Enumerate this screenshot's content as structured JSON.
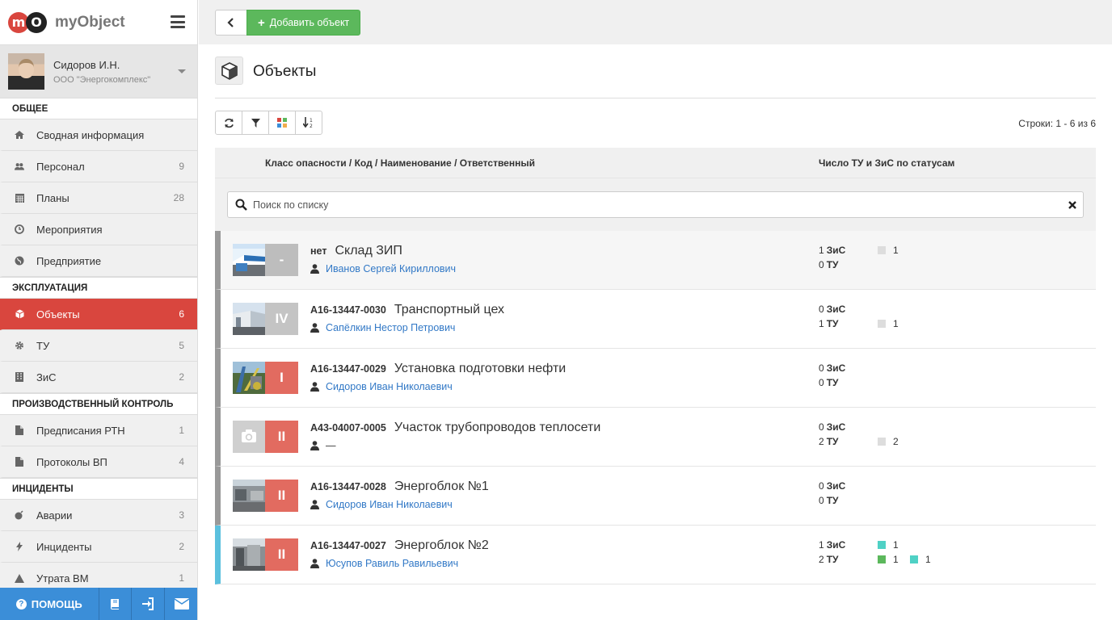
{
  "brand": {
    "logo_letter_1": "m",
    "logo_letter_2": "O",
    "name": "myObject"
  },
  "user": {
    "name": "Сидоров И.Н.",
    "org": "ООО \"Энергокомплекс\""
  },
  "sidebar": {
    "sections": [
      {
        "title": "ОБЩЕЕ",
        "items": [
          {
            "label": "Сводная информация",
            "count": "",
            "icon": "home-icon"
          },
          {
            "label": "Персонал",
            "count": "9",
            "icon": "users-icon"
          },
          {
            "label": "Планы",
            "count": "28",
            "icon": "calendar-icon"
          },
          {
            "label": "Мероприятия",
            "count": "",
            "icon": "clock-icon"
          },
          {
            "label": "Предприятие",
            "count": "",
            "icon": "globe-icon"
          }
        ]
      },
      {
        "title": "ЭКСПЛУАТАЦИЯ",
        "items": [
          {
            "label": "Объекты",
            "count": "6",
            "icon": "cube-icon",
            "active": true
          },
          {
            "label": "ТУ",
            "count": "5",
            "icon": "cog-icon"
          },
          {
            "label": "ЗиС",
            "count": "2",
            "icon": "building-icon"
          }
        ]
      },
      {
        "title": "ПРОИЗВОДСТВЕННЫЙ КОНТРОЛЬ",
        "items": [
          {
            "label": "Предписания РТН",
            "count": "1",
            "icon": "document-icon"
          },
          {
            "label": "Протоколы ВП",
            "count": "4",
            "icon": "document-icon"
          }
        ]
      },
      {
        "title": "ИНЦИДЕНТЫ",
        "items": [
          {
            "label": "Аварии",
            "count": "3",
            "icon": "bomb-icon"
          },
          {
            "label": "Инциденты",
            "count": "2",
            "icon": "bolt-icon"
          },
          {
            "label": "Утрата ВМ",
            "count": "1",
            "icon": "warning-icon"
          }
        ]
      }
    ],
    "help_label": "ПОМОЩЬ"
  },
  "topbar": {
    "add_label": "Добавить объект"
  },
  "page": {
    "title": "Объекты",
    "rows_info": "Строки: 1 - 6 из 6"
  },
  "table": {
    "headers": [
      "Класс опасности / Код / Наименование / Ответственный",
      "Число ТУ и ЗиС по статусам"
    ],
    "search_placeholder": "Поиск по списку",
    "rows": [
      {
        "code": "нет",
        "name": "Склад ЗИП",
        "responsible": "Иванов Сергей Кириллович",
        "class": "-",
        "class_color": "#bdbdbd",
        "thumb": "warehouse",
        "zis_count": "1",
        "zis_label": "ЗиС",
        "tu_count": "0",
        "tu_label": "ТУ",
        "bar_color": "#999999",
        "zis_status": [
          {
            "color": "#dddddd",
            "value": "1"
          }
        ],
        "tu_status": []
      },
      {
        "code": "А16-13447-0030",
        "name": "Транспортный цех",
        "responsible": "Сапёлкин Нестор Петрович",
        "class": "IV",
        "class_color": "#c4c4c4",
        "thumb": "hangar",
        "zis_count": "0",
        "zis_label": "ЗиС",
        "tu_count": "1",
        "tu_label": "ТУ",
        "bar_color": "#999999",
        "zis_status": [],
        "tu_status": [
          {
            "color": "#dddddd",
            "value": "1"
          }
        ]
      },
      {
        "code": "А16-13447-0029",
        "name": "Установка подготовки нефти",
        "responsible": "Сидоров Иван Николаевич",
        "class": "I",
        "class_color": "#e26b60",
        "thumb": "plant",
        "zis_count": "0",
        "zis_label": "ЗиС",
        "tu_count": "0",
        "tu_label": "ТУ",
        "bar_color": "#999999",
        "zis_status": [],
        "tu_status": []
      },
      {
        "code": "А43-04007-0005",
        "name": "Участок трубопроводов теплосети",
        "responsible": "—",
        "class": "II",
        "class_color": "#e26b60",
        "thumb": "camera",
        "zis_count": "0",
        "zis_label": "ЗиС",
        "tu_count": "2",
        "tu_label": "ТУ",
        "bar_color": "#999999",
        "zis_status": [],
        "tu_status": [
          {
            "color": "#dddddd",
            "value": "2"
          }
        ]
      },
      {
        "code": "А16-13447-0028",
        "name": "Энергоблок №1",
        "responsible": "Сидоров Иван Николаевич",
        "class": "II",
        "class_color": "#e26b60",
        "thumb": "energy",
        "zis_count": "0",
        "zis_label": "ЗиС",
        "tu_count": "0",
        "tu_label": "ТУ",
        "bar_color": "#999999",
        "zis_status": [],
        "tu_status": []
      },
      {
        "code": "А16-13447-0027",
        "name": "Энергоблок №2",
        "responsible": "Юсупов Равиль Равильевич",
        "class": "II",
        "class_color": "#e26b60",
        "thumb": "energy2",
        "zis_count": "1",
        "zis_label": "ЗиС",
        "tu_count": "2",
        "tu_label": "ТУ",
        "bar_color": "#5bc0de",
        "zis_status": [
          {
            "color": "#4fd1c5",
            "value": "1"
          }
        ],
        "tu_status": [
          {
            "color": "#5cb85c",
            "value": "1"
          },
          {
            "color": "#4fd1c5",
            "value": "1"
          }
        ]
      }
    ]
  }
}
